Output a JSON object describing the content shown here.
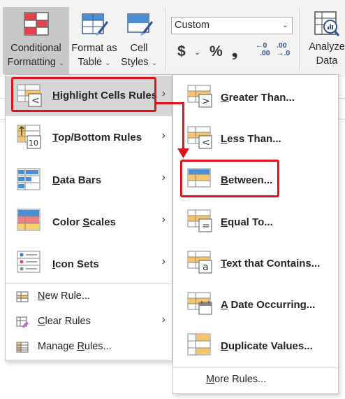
{
  "ribbon": {
    "conditional_formatting": {
      "line1": "Conditional",
      "line2": "Formatting",
      "caret": "⌄"
    },
    "format_as_table": {
      "line1": "Format as",
      "line2": "Table",
      "caret": "⌄"
    },
    "cell_styles": {
      "line1": "Cell",
      "line2": "Styles",
      "caret": "⌄"
    },
    "number_format": {
      "value": "Custom",
      "dropdown": "⌄"
    },
    "currency_symbol": "$",
    "currency_caret": "⌄",
    "percent_symbol": "%",
    "comma_symbol": "❟",
    "increase_decimal": {
      "top": "←0",
      "bottom": ".00"
    },
    "decrease_decimal": {
      "top": ".00",
      "bottom": "→.0"
    },
    "analyze_data": {
      "line1": "Analyze",
      "line2": "Data"
    }
  },
  "main_menu": {
    "items": [
      {
        "pre": "",
        "u": "H",
        "post": "ighlight Cells Rules",
        "chevron": "›",
        "icon": "highlight-cells-icon"
      },
      {
        "pre": "",
        "u": "T",
        "post": "op/Bottom Rules",
        "chevron": "›",
        "icon": "top-bottom-icon"
      },
      {
        "pre": "",
        "u": "D",
        "post": "ata Bars",
        "chevron": "›",
        "icon": "data-bars-icon"
      },
      {
        "pre": "Color ",
        "u": "S",
        "post": "cales",
        "chevron": "›",
        "icon": "color-scales-icon"
      },
      {
        "pre": "",
        "u": "I",
        "post": "con Sets",
        "chevron": "›",
        "icon": "icon-sets-icon"
      }
    ],
    "small_items": [
      {
        "pre": "",
        "u": "N",
        "post": "ew Rule...",
        "icon": "new-rule-icon"
      },
      {
        "pre": "",
        "u": "C",
        "post": "lear Rules",
        "chevron": "›",
        "icon": "clear-rules-icon"
      },
      {
        "pre": "Manage ",
        "u": "R",
        "post": "ules...",
        "icon": "manage-rules-icon"
      }
    ]
  },
  "sub_menu": {
    "items": [
      {
        "pre": "",
        "u": "G",
        "post": "reater Than...",
        "icon": "greater-than-icon",
        "glyph": ">"
      },
      {
        "pre": "",
        "u": "L",
        "post": "ess Than...",
        "icon": "less-than-icon",
        "glyph": "<"
      },
      {
        "pre": "",
        "u": "B",
        "post": "etween...",
        "icon": "between-icon",
        "glyph": ""
      },
      {
        "pre": "",
        "u": "E",
        "post": "qual To...",
        "icon": "equal-to-icon",
        "glyph": "="
      },
      {
        "pre": "",
        "u": "T",
        "post": "ext that Contains...",
        "icon": "text-contains-icon",
        "glyph": "a"
      },
      {
        "pre": "",
        "u": "A",
        "post": " Date Occurring...",
        "icon": "date-occurring-icon",
        "glyph": ""
      },
      {
        "pre": "",
        "u": "D",
        "post": "uplicate Values...",
        "icon": "duplicate-values-icon",
        "glyph": ""
      }
    ],
    "more_rules": {
      "pre": "",
      "u": "M",
      "post": "ore Rules..."
    }
  },
  "icon_glyphs": {
    "highlight_badge": "<",
    "top_bottom_badge": "10"
  },
  "colors": {
    "accent_red": "#e0111a",
    "highlight_orange": "#f6c56a",
    "bar_blue": "#4a8fd1",
    "scale_red": "#f08080",
    "scale_yellow": "#f6d26b",
    "hover_gray": "#d6d6d6"
  }
}
